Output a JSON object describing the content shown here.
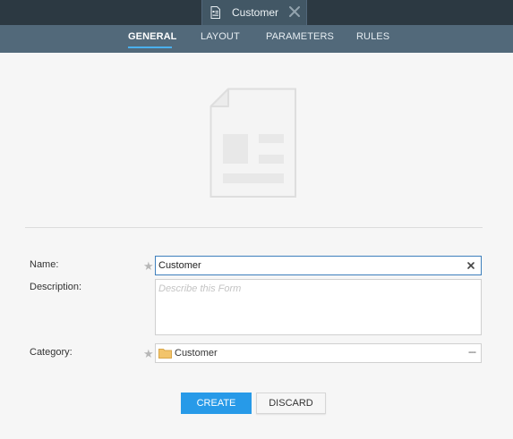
{
  "tab": {
    "title": "Customer",
    "icon": "form-document-icon",
    "close_icon": "close-icon"
  },
  "nav": {
    "items": [
      {
        "label": "GENERAL",
        "active": true
      },
      {
        "label": "LAYOUT",
        "active": false
      },
      {
        "label": "PARAMETERS",
        "active": false
      },
      {
        "label": "RULES",
        "active": false
      }
    ],
    "active_color": "#4ab0ee"
  },
  "form": {
    "name_label": "Name:",
    "name_value": "Customer",
    "description_label": "Description:",
    "description_placeholder": "Describe this Form",
    "category_label": "Category:",
    "category_value": "Customer",
    "required_mark": "★",
    "more_glyph": "---"
  },
  "buttons": {
    "create": "CREATE",
    "discard": "DISCARD"
  },
  "colors": {
    "title_bar": "#2c3942",
    "nav_bar": "#52697a",
    "primary": "#279ae8",
    "focus_border": "#3e7fbc"
  }
}
